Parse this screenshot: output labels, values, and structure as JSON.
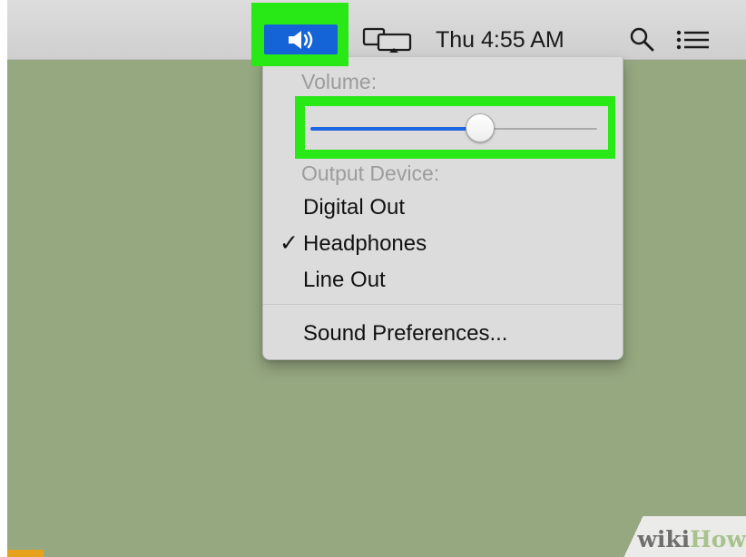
{
  "menubar": {
    "clock": "Thu 4:55 AM",
    "icons": {
      "sound": "speaker-volume-icon",
      "display": "display-mirroring-icon",
      "search": "search-icon",
      "menu": "notification-list-icon"
    },
    "accent_color": "#1463d7"
  },
  "highlights": {
    "color": "#28e816"
  },
  "sound_menu": {
    "volume_label": "Volume:",
    "volume_level": 0.57,
    "output_label": "Output Device:",
    "devices": [
      {
        "label": "Digital Out",
        "checked": false
      },
      {
        "label": "Headphones",
        "checked": true
      },
      {
        "label": "Line Out",
        "checked": false
      }
    ],
    "preferences_label": "Sound Preferences...",
    "checkmark": "✓"
  },
  "watermark": {
    "wiki": "wiki",
    "how": "How"
  }
}
